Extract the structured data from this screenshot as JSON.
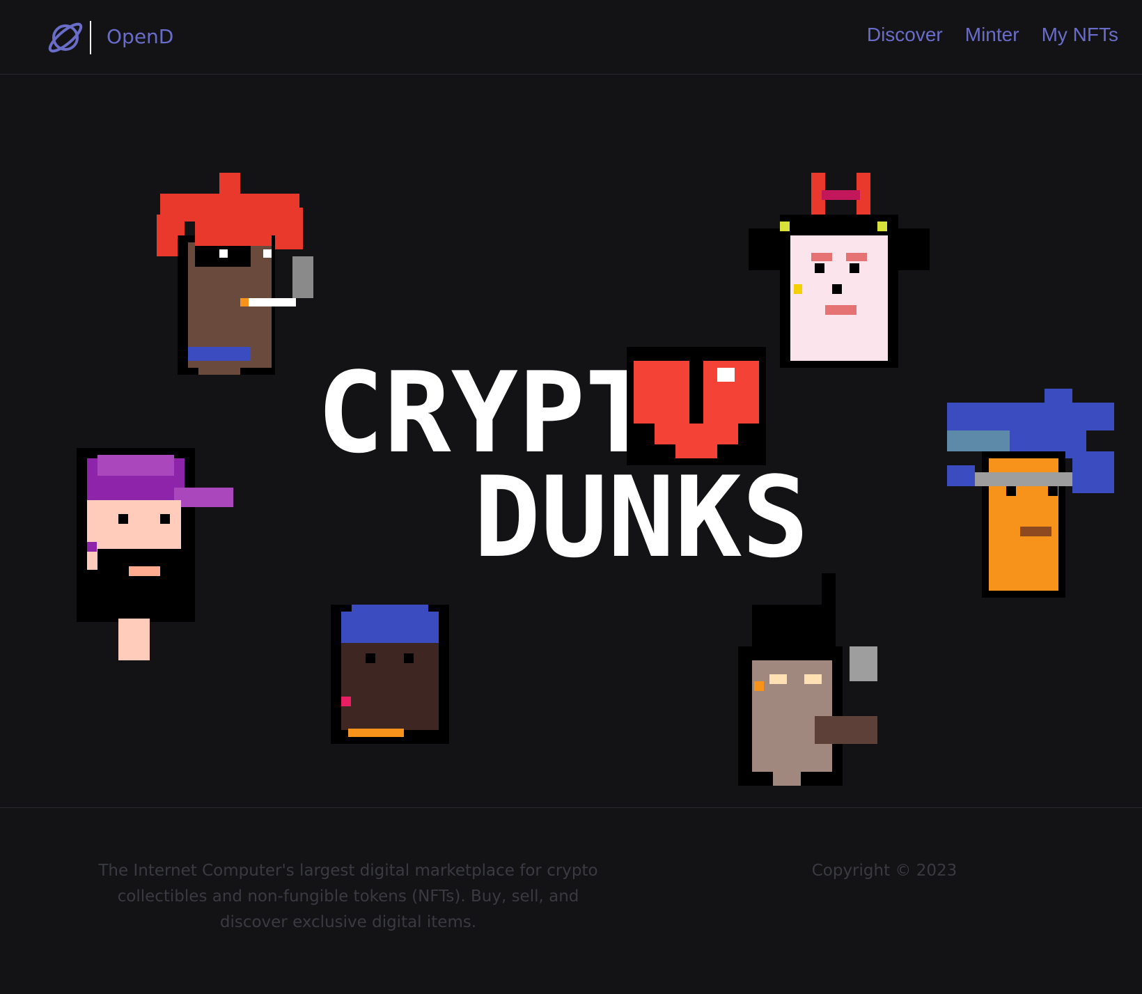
{
  "header": {
    "brand": "OpenD",
    "logo_icon": "planet-icon",
    "nav": [
      {
        "label": "Discover"
      },
      {
        "label": "Minter"
      },
      {
        "label": "My NFTs"
      }
    ],
    "nav_color": "#6a6dc8"
  },
  "hero": {
    "banner_line1": "CRYPT",
    "banner_line2": "DUNKS",
    "heart_icon": "pixel-heart-icon"
  },
  "footer": {
    "description": "The Internet Computer's largest digital marketplace for crypto collectibles and non-fungible tokens (NFTs). Buy, sell, and discover exclusive digital items.",
    "copyright": "Copyright © 2023"
  },
  "colors": {
    "background": "#131316",
    "accent": "#6a6dc8",
    "footer_text": "#3a3a42"
  }
}
